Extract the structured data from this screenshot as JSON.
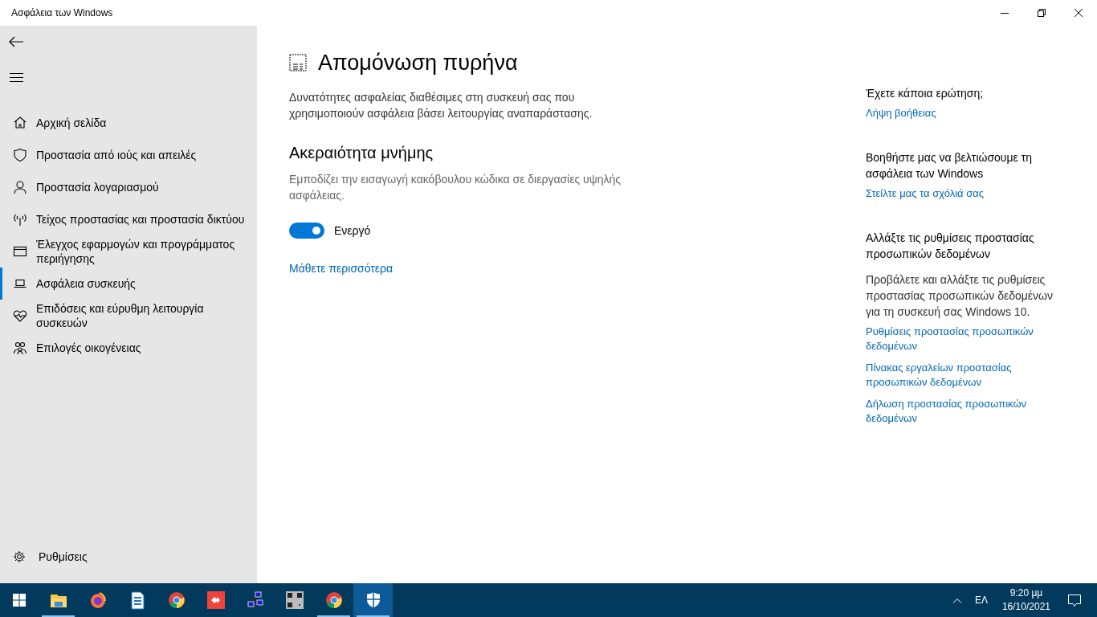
{
  "window": {
    "title": "Ασφάλεια των Windows"
  },
  "sidebar": {
    "items": [
      {
        "label": "Αρχική σελίδα",
        "selected": false
      },
      {
        "label": "Προστασία από ιούς και απειλές",
        "selected": false
      },
      {
        "label": "Προστασία λογαριασμού",
        "selected": false
      },
      {
        "label": "Τείχος προστασίας και προστασία δικτύου",
        "selected": false
      },
      {
        "label": "Έλεγχος εφαρμογών και προγράμματος περιήγησης",
        "selected": false
      },
      {
        "label": "Ασφάλεια συσκευής",
        "selected": true
      },
      {
        "label": "Επιδόσεις και εύρυθμη λειτουργία συσκευών",
        "selected": false
      },
      {
        "label": "Επιλογές οικογένειας",
        "selected": false
      }
    ],
    "settings": "Ρυθμίσεις"
  },
  "main": {
    "title": "Απομόνωση πυρήνα",
    "description": "Δυνατότητες ασφαλείας διαθέσιμες στη συσκευή σας που χρησιμοποιούν ασφάλεια βάσει λειτουργίας αναπαράστασης.",
    "section": {
      "heading": "Ακεραιότητα μνήμης",
      "description": "Εμποδίζει την εισαγωγή κακόβουλου κώδικα σε διεργασίες υψηλής ασφάλειας.",
      "toggle": {
        "on": true,
        "label": "Ενεργό"
      }
    },
    "link": "Μάθετε περισσότερα"
  },
  "aside": [
    {
      "heading": "Έχετε κάποια ερώτηση;",
      "links": [
        "Λήψη βοήθειας"
      ]
    },
    {
      "heading": "Βοηθήστε μας να βελτιώσουμε τη ασφάλεια των Windows",
      "links": [
        "Στείλτε μας τα σχόλιά σας"
      ]
    },
    {
      "heading": "Αλλάξτε τις ρυθμίσεις προστασίας προσωπικών δεδομένων",
      "text": "Προβάλετε και αλλάξτε τις ρυθμίσεις προστασίας προσωπικών δεδομένων για τη συσκευή σας Windows 10.",
      "links": [
        "Ρυθμίσεις προστασίας προσωπικών δεδομένων",
        "Πίνακας εργαλείων προστασίας προσωπικών δεδομένων",
        "Δήλωση προστασίας προσωπικών δεδομένων"
      ]
    }
  ],
  "taskbar": {
    "apps": [
      {
        "kind": "folder",
        "running": true,
        "selected": false
      },
      {
        "kind": "firefox",
        "running": false,
        "selected": false
      },
      {
        "kind": "writer",
        "running": false,
        "selected": false
      },
      {
        "kind": "chrome",
        "running": false,
        "selected": false
      },
      {
        "kind": "remote",
        "running": false,
        "selected": false
      },
      {
        "kind": "network",
        "running": false,
        "selected": false
      },
      {
        "kind": "qr",
        "running": false,
        "selected": false
      },
      {
        "kind": "chrome",
        "running": true,
        "selected": false
      },
      {
        "kind": "shield",
        "running": true,
        "selected": true
      }
    ],
    "language": "ΕΛ",
    "time": "9:20 μμ",
    "date": "16/10/2021"
  }
}
